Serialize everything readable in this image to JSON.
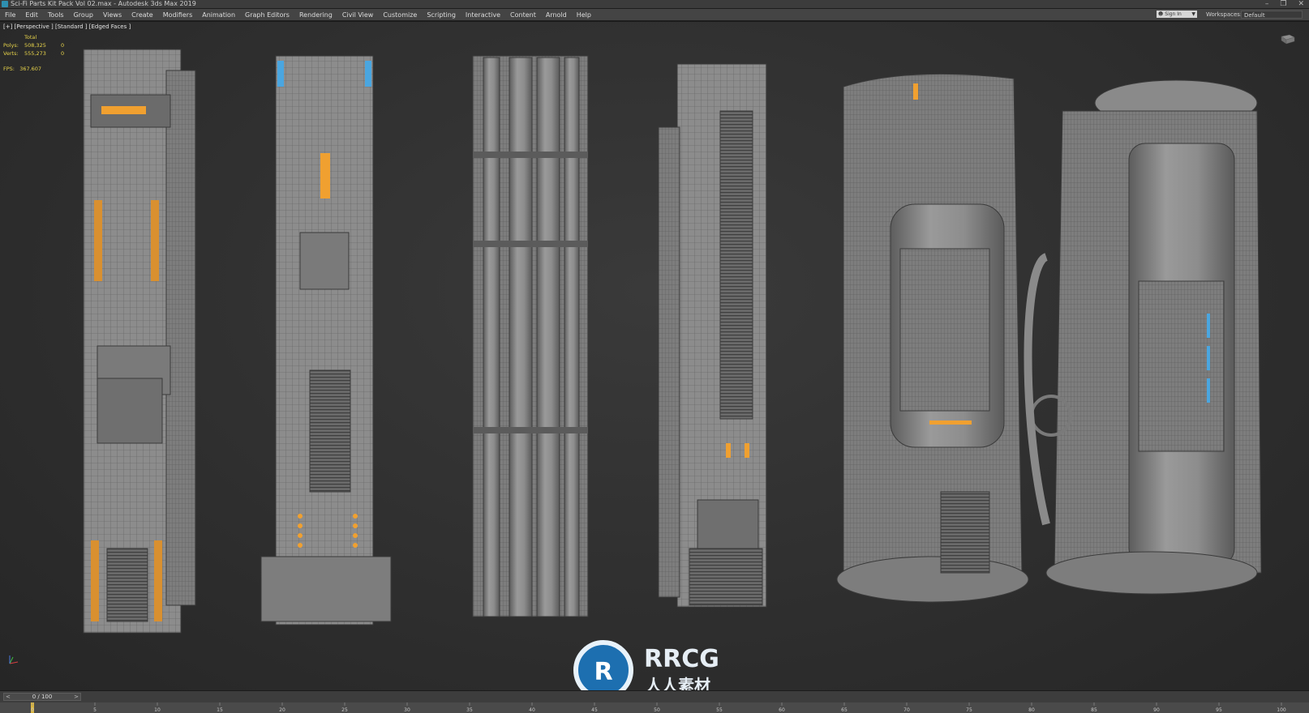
{
  "window": {
    "title": "Sci-Fi Parts Kit Pack  Vol 02.max - Autodesk 3ds Max 2019",
    "controls": [
      "–",
      "❐",
      "✕"
    ]
  },
  "menu": {
    "items": [
      "File",
      "Edit",
      "Tools",
      "Group",
      "Views",
      "Create",
      "Modifiers",
      "Animation",
      "Graph Editors",
      "Rendering",
      "Civil View",
      "Customize",
      "Scripting",
      "Interactive",
      "Content",
      "Arnold",
      "Help"
    ],
    "signin": "Sign In",
    "workspaces_label": "Workspaces:",
    "workspace_value": "Default"
  },
  "viewport": {
    "label": "[+] [Perspective ] [Standard ] [Edged Faces ]",
    "stats": {
      "header": "Total",
      "polys_label": "Polys:",
      "polys_total": "508,325",
      "polys_sel": "0",
      "verts_label": "Verts:",
      "verts_total": "555,273",
      "verts_sel": "0",
      "fps_label": "FPS:",
      "fps_value": "367.607"
    }
  },
  "timeline": {
    "frame": "0 / 100",
    "ticks": [
      "0",
      "5",
      "10",
      "15",
      "20",
      "25",
      "30",
      "35",
      "40",
      "45",
      "50",
      "55",
      "60",
      "65",
      "70",
      "75",
      "80",
      "85",
      "90",
      "95",
      "100"
    ]
  },
  "watermark": {
    "brand": "RRCG",
    "chinese": "人人素材"
  },
  "colors": {
    "accent_orange": "#f0a030",
    "accent_blue": "#4aa6e0",
    "wire": "#3a3a3a",
    "model_gray": "#8a8a8a"
  }
}
